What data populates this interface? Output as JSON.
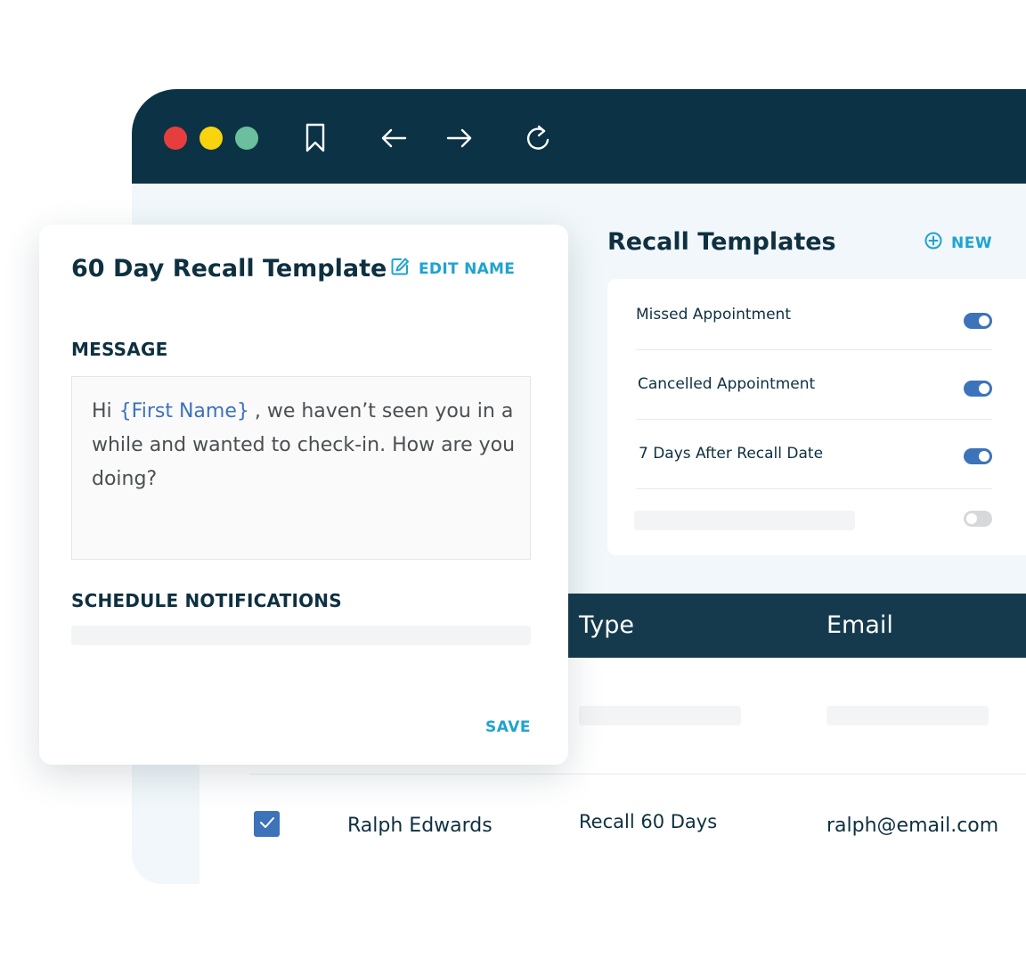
{
  "recall_panel": {
    "title": "Recall Templates",
    "new_label": "NEW",
    "templates": [
      {
        "label": "Missed Appointment",
        "enabled": true
      },
      {
        "label": "Cancelled Appointment",
        "enabled": true
      },
      {
        "label": "7 Days After Recall Date",
        "enabled": true
      },
      {
        "label": "",
        "enabled": false
      }
    ]
  },
  "table": {
    "columns": [
      "Type",
      "Email"
    ],
    "row": {
      "checked": true,
      "name": "Ralph Edwards",
      "type": "Recall 60 Days",
      "email": "ralph@email.com"
    }
  },
  "modal": {
    "title": "60 Day Recall Template",
    "edit_label": "EDIT NAME",
    "message_heading": "MESSAGE",
    "message": {
      "greeting": "Hi",
      "variable": "{First Name}",
      "body": ", we haven’t seen you in a while and wanted to check-in. How are you doing?"
    },
    "schedule_heading": "SCHEDULE NOTIFICATIONS",
    "save_label": "SAVE"
  },
  "colors": {
    "titlebar": "#0b3345",
    "accent": "#1fa3d1",
    "toggle_on": "#3d73b9",
    "dot_red": "#e63e3e",
    "dot_yellow": "#f8d40f",
    "dot_green": "#6cbf9e"
  },
  "icons": {
    "toolbar": [
      "bookmark-icon",
      "arrow-left-icon",
      "arrow-right-icon",
      "refresh-icon"
    ],
    "new": "plus-circle-icon",
    "edit": "edit-icon",
    "checkbox": "check-icon"
  }
}
